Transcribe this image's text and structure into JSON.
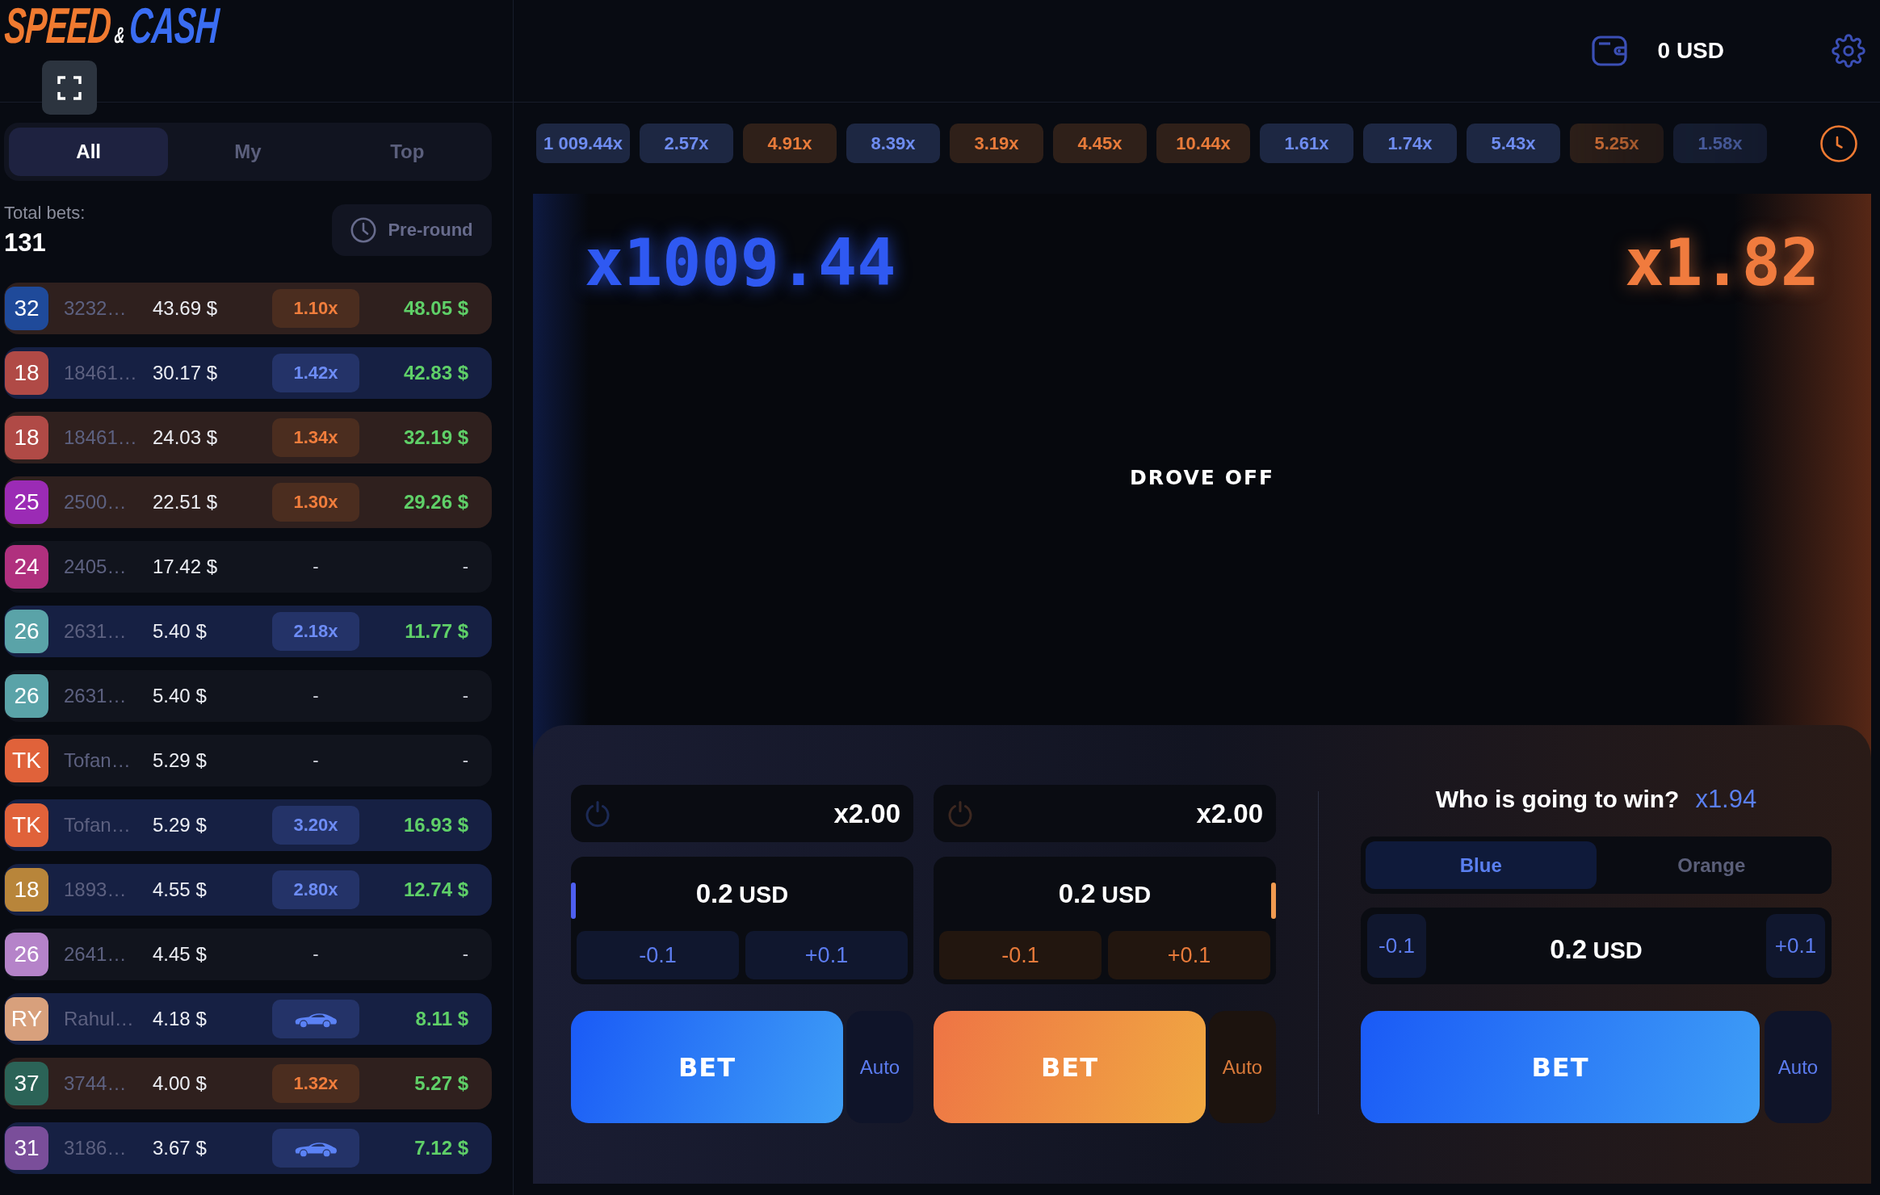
{
  "logo": {
    "word_1": "SPEED",
    "ampersand": "&",
    "word_2": "CASH"
  },
  "balance": {
    "amount": "0 USD"
  },
  "bets_panel": {
    "tabs": [
      {
        "label": "All",
        "selected": true
      },
      {
        "label": "My",
        "selected": false
      },
      {
        "label": "Top",
        "selected": false
      }
    ],
    "total_bets": {
      "label": "Total bets:",
      "value": "131"
    },
    "round_filter": {
      "label": "Pre-round"
    },
    "rows": [
      {
        "avatar": {
          "text": "32",
          "color": "#1f4a9a"
        },
        "player": "3232…",
        "bet": "43.69 $",
        "kind": "orange",
        "multiplier": "1.10x",
        "win": "48.05 $"
      },
      {
        "avatar": {
          "text": "18",
          "color": "#b04a46"
        },
        "player": "18461…",
        "bet": "30.17 $",
        "kind": "blue",
        "multiplier": "1.42x",
        "win": "42.83 $"
      },
      {
        "avatar": {
          "text": "18",
          "color": "#b04a46"
        },
        "player": "18461…",
        "bet": "24.03 $",
        "kind": "orange",
        "multiplier": "1.34x",
        "win": "32.19 $"
      },
      {
        "avatar": {
          "text": "25",
          "color": "#9b2bb5"
        },
        "player": "2500…",
        "bet": "22.51 $",
        "kind": "orange",
        "multiplier": "1.30x",
        "win": "29.26 $"
      },
      {
        "avatar": {
          "text": "24",
          "color": "#b0307e"
        },
        "player": "2405…",
        "bet": "17.42 $",
        "kind": "pending",
        "multiplier": "-",
        "win": "-"
      },
      {
        "avatar": {
          "text": "26",
          "color": "#5aa3a8"
        },
        "player": "2631…",
        "bet": "5.40 $",
        "kind": "blue",
        "multiplier": "2.18x",
        "win": "11.77 $"
      },
      {
        "avatar": {
          "text": "26",
          "color": "#5aa3a8"
        },
        "player": "2631…",
        "bet": "5.40 $",
        "kind": "pending",
        "multiplier": "-",
        "win": "-"
      },
      {
        "avatar": {
          "text": "TK",
          "color": "#e0623a"
        },
        "player": "Tofan…",
        "bet": "5.29 $",
        "kind": "pending",
        "multiplier": "-",
        "win": "-"
      },
      {
        "avatar": {
          "text": "TK",
          "color": "#e0623a"
        },
        "player": "Tofan…",
        "bet": "5.29 $",
        "kind": "blue",
        "multiplier": "3.20x",
        "win": "16.93 $"
      },
      {
        "avatar": {
          "text": "18",
          "color": "#b8853a"
        },
        "player": "1893…",
        "bet": "4.55 $",
        "kind": "blue",
        "multiplier": "2.80x",
        "win": "12.74 $"
      },
      {
        "avatar": {
          "text": "26",
          "color": "#b583c9"
        },
        "player": "2641…",
        "bet": "4.45 $",
        "kind": "pending",
        "multiplier": "-",
        "win": "-"
      },
      {
        "avatar": {
          "text": "RY",
          "color": "#d8a07c"
        },
        "player": "Rahul…",
        "bet": "4.18 $",
        "kind": "car",
        "win": "8.11 $"
      },
      {
        "avatar": {
          "text": "37",
          "color": "#2b6357"
        },
        "player": "3744…",
        "bet": "4.00 $",
        "kind": "orange",
        "multiplier": "1.32x",
        "win": "5.27 $"
      },
      {
        "avatar": {
          "text": "31",
          "color": "#7a4e9a"
        },
        "player": "3186…",
        "bet": "3.67 $",
        "kind": "car",
        "win": "7.12 $"
      }
    ]
  },
  "history": [
    {
      "value": "1 009.44x",
      "kind": "blue"
    },
    {
      "value": "2.57x",
      "kind": "blue"
    },
    {
      "value": "4.91x",
      "kind": "orange"
    },
    {
      "value": "8.39x",
      "kind": "blue"
    },
    {
      "value": "3.19x",
      "kind": "orange"
    },
    {
      "value": "4.45x",
      "kind": "orange"
    },
    {
      "value": "10.44x",
      "kind": "orange"
    },
    {
      "value": "1.61x",
      "kind": "blue"
    },
    {
      "value": "1.74x",
      "kind": "blue"
    },
    {
      "value": "5.43x",
      "kind": "blue"
    },
    {
      "value": "5.25x",
      "kind": "orange"
    },
    {
      "value": "1.58x",
      "kind": "blue"
    }
  ],
  "stage": {
    "blue_multiplier": "x1009.44",
    "orange_multiplier": "x1.82",
    "status": "DROVE OFF"
  },
  "bet_cards": [
    {
      "kind": "blue",
      "auto_cashout": {
        "enabled": false,
        "value": "x2.00"
      },
      "amount": "0.2",
      "currency": "USD",
      "decrease": "-0.1",
      "increase": "+0.1",
      "bet": "BET",
      "auto": "Auto"
    },
    {
      "kind": "orange",
      "auto_cashout": {
        "enabled": false,
        "value": "x2.00"
      },
      "amount": "0.2",
      "currency": "USD",
      "decrease": "-0.1",
      "increase": "+0.1",
      "bet": "BET",
      "auto": "Auto"
    }
  ],
  "prediction": {
    "question": "Who is going to win?",
    "odds": "x1.94",
    "options": [
      {
        "label": "Blue",
        "selected": true
      },
      {
        "label": "Orange",
        "selected": false
      }
    ],
    "decrease": "-0.1",
    "amount": "0.2",
    "currency": "USD",
    "increase": "+0.1",
    "bet": "BET",
    "auto": "Auto"
  }
}
